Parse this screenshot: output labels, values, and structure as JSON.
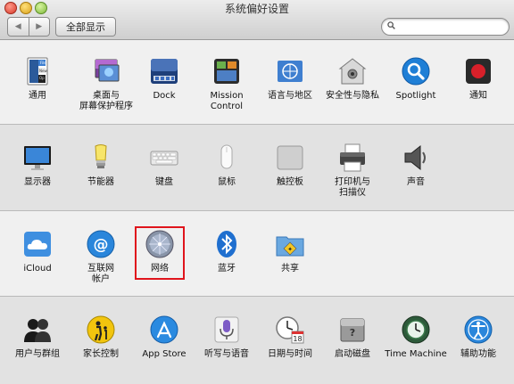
{
  "window": {
    "title": "系统偏好设置",
    "nav_back": "◀",
    "nav_forward": "▶",
    "show_all": "全部显示",
    "search_value": ""
  },
  "sections": {
    "personal": [
      {
        "label": "通用",
        "icon": "general-icon"
      },
      {
        "label": "桌面与\n屏幕保护程序",
        "icon": "desktop-screensaver-icon"
      },
      {
        "label": "Dock",
        "icon": "dock-icon"
      },
      {
        "label": "Mission\nControl",
        "icon": "mission-control-icon"
      },
      {
        "label": "语言与地区",
        "icon": "language-region-icon",
        "badge": "UN"
      },
      {
        "label": "安全性与隐私",
        "icon": "security-privacy-icon"
      },
      {
        "label": "Spotlight",
        "icon": "spotlight-icon"
      },
      {
        "label": "通知",
        "icon": "notifications-icon"
      }
    ],
    "hardware": [
      {
        "label": "显示器",
        "icon": "displays-icon"
      },
      {
        "label": "节能器",
        "icon": "energy-saver-icon"
      },
      {
        "label": "键盘",
        "icon": "keyboard-icon"
      },
      {
        "label": "鼠标",
        "icon": "mouse-icon"
      },
      {
        "label": "触控板",
        "icon": "trackpad-icon"
      },
      {
        "label": "打印机与\n扫描仪",
        "icon": "printers-scanners-icon"
      },
      {
        "label": "声音",
        "icon": "sound-icon"
      }
    ],
    "internet": [
      {
        "label": "iCloud",
        "icon": "icloud-icon"
      },
      {
        "label": "互联网\n帐户",
        "icon": "internet-accounts-icon"
      },
      {
        "label": "网络",
        "icon": "network-icon"
      },
      {
        "label": "蓝牙",
        "icon": "bluetooth-icon"
      },
      {
        "label": "共享",
        "icon": "sharing-icon"
      }
    ],
    "system": [
      {
        "label": "用户与群组",
        "icon": "users-groups-icon"
      },
      {
        "label": "家长控制",
        "icon": "parental-controls-icon"
      },
      {
        "label": "App Store",
        "icon": "app-store-icon"
      },
      {
        "label": "听写与语音",
        "icon": "dictation-speech-icon"
      },
      {
        "label": "日期与时间",
        "icon": "date-time-icon",
        "badge": "18"
      },
      {
        "label": "启动磁盘",
        "icon": "startup-disk-icon"
      },
      {
        "label": "Time Machine",
        "icon": "time-machine-icon"
      },
      {
        "label": "辅助功能",
        "icon": "accessibility-icon"
      }
    ]
  },
  "colors": {
    "highlight_border": "#e0141c",
    "spotlight_blue": "#1f7fd6",
    "notifications_red": "#d8202a"
  }
}
